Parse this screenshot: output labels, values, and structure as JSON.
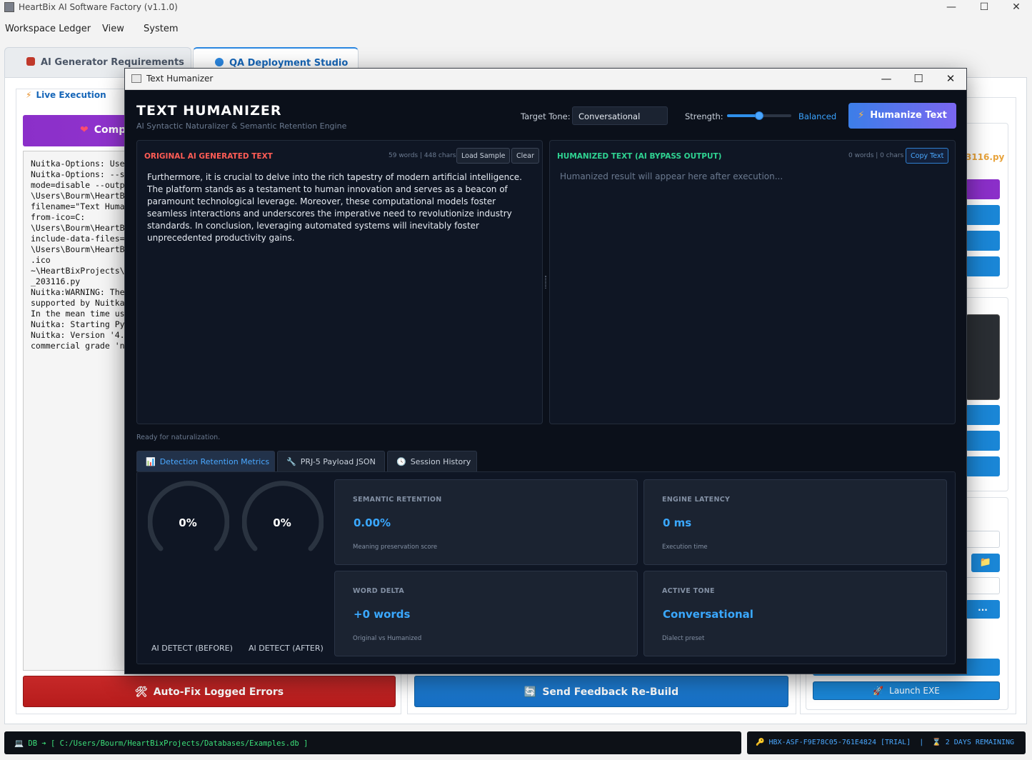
{
  "window": {
    "title": "HeartBix AI Software Factory (v1.1.0)",
    "controls": {
      "minimize": "—",
      "maximize": "☐",
      "close": "✕"
    }
  },
  "menu": [
    "Workspace Ledger",
    "View",
    "System"
  ],
  "tabs": [
    {
      "label": "AI Generator  Requirements",
      "active": false
    },
    {
      "label": "QA  Deployment Studio",
      "active": true
    }
  ],
  "left_panel": {
    "section_label": "Live Execution",
    "purple_button": "Comp",
    "console_lines": [
      "Nuitka-Options: Use",
      "Nuitka-Options: --s",
      "mode=disable --outp",
      "\\Users\\Bourm\\HeartB",
      "filename=\"Text Huma",
      "from-ico=C:",
      "\\Users\\Bourm\\HeartB",
      "include-data-files=",
      "\\Users\\Bourm\\HeartB",
      ".ico",
      "~\\HeartBixProjects\\",
      "_203116.py",
      "Nuitka:WARNING: The",
      "supported by Nuitka",
      "In the mean time us",
      "Nuitka: Starting Py",
      "Nuitka: Version '4.",
      "commercial grade 'n"
    ]
  },
  "right_panel": {
    "file_label": "3116.py",
    "dots_button": "...",
    "launch_button": "Launch EXE"
  },
  "bottom_buttons": {
    "autofix": "Auto-Fix Logged Errors",
    "feedback": "Send Feedback  Re-Build"
  },
  "status": {
    "db_prefix": "DB ➔",
    "db_path": "[ C:/Users/Bourm/HeartBixProjects/Databases/Examples.db ]",
    "license": "HBX-ASF-F9E78C05-761E4824 [TRIAL]",
    "separator": "|",
    "remaining": "2 DAYS REMAINING"
  },
  "dialog": {
    "window_title": "Text Humanizer",
    "heading": "TEXT HUMANIZER",
    "subheading": "AI Syntactic Naturalizer & Semantic Retention Engine",
    "target_tone_label": "Target Tone:",
    "target_tone_value": "Conversational",
    "strength_label": "Strength:",
    "strength_value": "Balanced",
    "strength_level": 0.5,
    "humanize_button": "Humanize Text",
    "original": {
      "header": "ORIGINAL AI GENERATED TEXT",
      "count": "59 words | 448 chars",
      "load_button": "Load Sample",
      "clear_button": "Clear",
      "text": "Furthermore, it is crucial to delve into the rich tapestry of modern artificial intelligence. The platform stands as a testament to human innovation and serves as a beacon of paramount technological leverage. Moreover, these computational models foster seamless interactions and underscores the imperative need to revolutionize industry standards. In conclusion, leveraging automated systems will inevitably foster unprecedented productivity gains."
    },
    "humanized": {
      "header": "HUMANIZED TEXT (AI BYPASS OUTPUT)",
      "count": "0 words | 0 chars",
      "copy_button": "Copy Text",
      "placeholder": "Humanized result will appear here after execution..."
    },
    "status_text": "Ready for naturalization.",
    "subtabs": [
      {
        "label": "Detection  Retention Metrics",
        "icon": "📊",
        "active": true
      },
      {
        "label": "PRJ-5 Payload JSON",
        "icon": "🔧",
        "active": false
      },
      {
        "label": "Session History",
        "icon": "🕓",
        "active": false
      }
    ],
    "gauges": [
      {
        "value": "0%",
        "label": "AI DETECT (BEFORE)",
        "fraction": 0
      },
      {
        "value": "0%",
        "label": "AI DETECT (AFTER)",
        "fraction": 0
      }
    ],
    "metrics": [
      {
        "label": "SEMANTIC RETENTION",
        "value": "0.00%",
        "desc": "Meaning preservation score"
      },
      {
        "label": "ENGINE LATENCY",
        "value": "0 ms",
        "desc": "Execution time"
      },
      {
        "label": "WORD DELTA",
        "value": "+0 words",
        "desc": "Original vs Humanized"
      },
      {
        "label": "ACTIVE TONE",
        "value": "Conversational",
        "desc": "Dialect preset"
      }
    ]
  },
  "colors": {
    "accent_blue": "#1a86d6",
    "purple": "#8b2fc9",
    "danger_red": "#c62828",
    "dialog_bg": "#0b101a",
    "metric_blue": "#3aa8ff"
  }
}
